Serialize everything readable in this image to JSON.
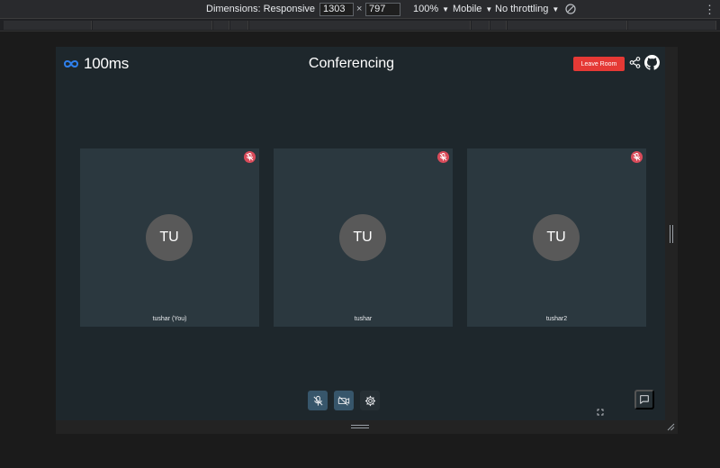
{
  "devtools": {
    "dimensions_label": "Dimensions: Responsive",
    "width_value": "1303",
    "height_value": "797",
    "zoom": "100%",
    "device": "Mobile",
    "throttling": "No throttling",
    "times": "×",
    "kebab": "⋮",
    "caret": "▼"
  },
  "app": {
    "brand": "100ms",
    "title": "Conferencing",
    "leave_label": "Leave Room",
    "accent": "#e53935",
    "participants": [
      {
        "initials": "TU",
        "name": "tushar (You)",
        "audio": "muted"
      },
      {
        "initials": "TU",
        "name": "tushar",
        "audio": "muted"
      },
      {
        "initials": "TU",
        "name": "tushar2",
        "audio": "muted"
      }
    ],
    "controls": {
      "mic_icon": "mic-off-icon",
      "camera_icon": "video-off-icon",
      "settings_icon": "gear-icon",
      "chat_icon": "chat-icon"
    }
  }
}
